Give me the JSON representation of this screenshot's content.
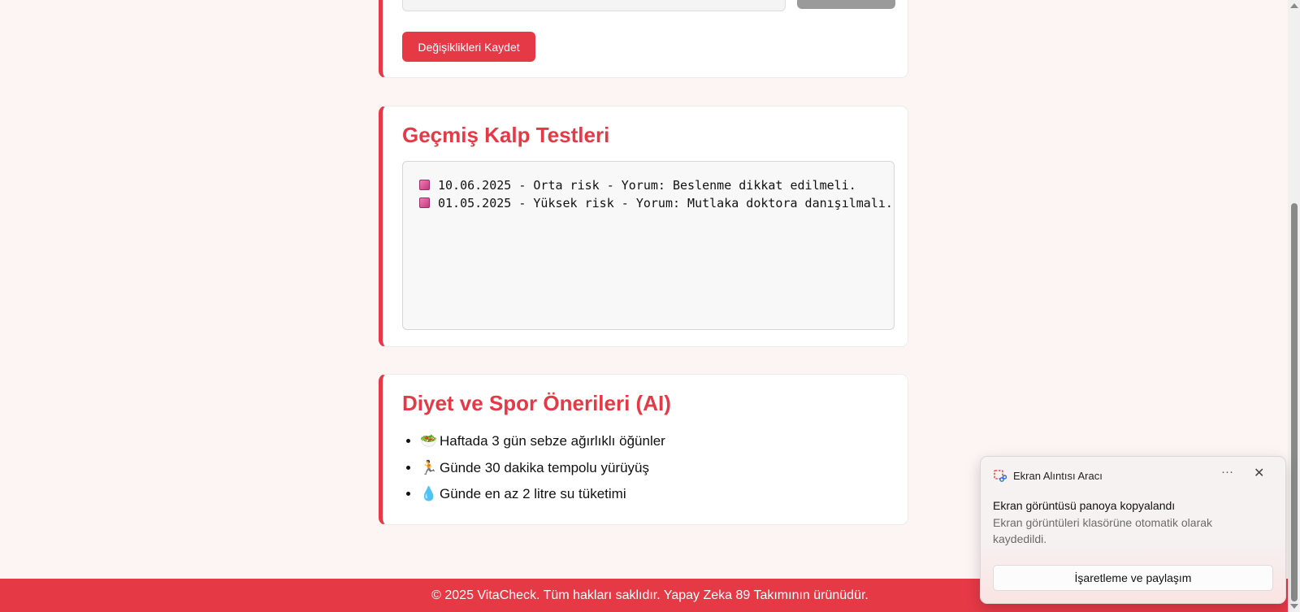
{
  "profile_form": {
    "save_label": "Değişiklikleri Kaydet"
  },
  "history": {
    "title": "Geçmiş Kalp Testleri",
    "entries": [
      {
        "icon": "gift-box-icon",
        "text": "10.06.2025 - Orta risk - Yorum: Beslenme dikkat edilmeli."
      },
      {
        "icon": "gift-box-icon",
        "text": "01.05.2025 - Yüksek risk - Yorum: Mutlaka doktora danışılmalı."
      }
    ]
  },
  "diet": {
    "title": "Diyet ve Spor Önerileri (AI)",
    "items": [
      {
        "icon": "🥗",
        "text": "Haftada 3 gün sebze ağırlıklı öğünler"
      },
      {
        "icon": "🏃",
        "text": "Günde 30 dakika tempolu yürüyüş"
      },
      {
        "icon": "💧",
        "text": "Günde en az 2 litre su tüketimi"
      }
    ]
  },
  "footer": {
    "text": "© 2025 VitaCheck. Tüm hakları saklıdır. Yapay Zeka 89 Takımının ürünüdür."
  },
  "notification": {
    "app_name": "Ekran Alıntısı Aracı",
    "more_icon": "···",
    "close_icon": "✕",
    "title": "Ekran görüntüsü panoya kopyalandı",
    "body": "Ekran görüntüleri klasörüne otomatik olarak kaydedildi.",
    "action_label": "İşaretleme ve paylaşım"
  },
  "colors": {
    "accent": "#e63946",
    "page_bg": "#fdf5f3"
  }
}
